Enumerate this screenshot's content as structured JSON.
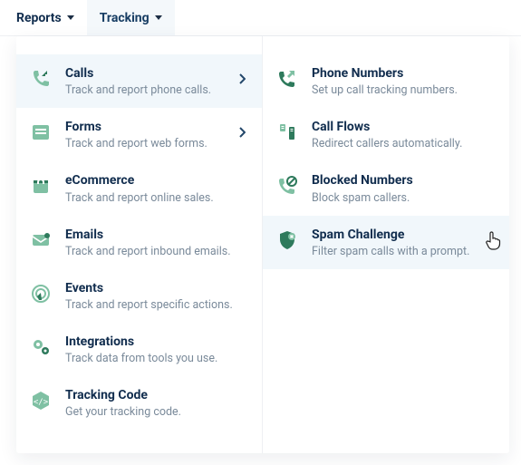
{
  "topnav": {
    "reports": "Reports",
    "tracking": "Tracking"
  },
  "left": [
    {
      "icon": "phone-in",
      "title": "Calls",
      "sub": "Track and report phone calls.",
      "chev": true,
      "hi": true
    },
    {
      "icon": "form",
      "title": "Forms",
      "sub": "Track and report web forms.",
      "chev": true,
      "hi": false
    },
    {
      "icon": "cart",
      "title": "eCommerce",
      "sub": "Track and report online sales.",
      "chev": false,
      "hi": false
    },
    {
      "icon": "mail",
      "title": "Emails",
      "sub": "Track and report inbound emails.",
      "chev": false,
      "hi": false
    },
    {
      "icon": "touch",
      "title": "Events",
      "sub": "Track and report specific actions.",
      "chev": false,
      "hi": false
    },
    {
      "icon": "gears",
      "title": "Integrations",
      "sub": "Track data from tools you use.",
      "chev": false,
      "hi": false
    },
    {
      "icon": "code",
      "title": "Tracking Code",
      "sub": "Get your tracking code.",
      "chev": false,
      "hi": false
    }
  ],
  "right": [
    {
      "icon": "phone",
      "title": "Phone Numbers",
      "sub": "Set up call tracking numbers.",
      "hi": false,
      "cursor": false
    },
    {
      "icon": "flow",
      "title": "Call Flows",
      "sub": "Redirect callers automatically.",
      "hi": false,
      "cursor": false
    },
    {
      "icon": "block",
      "title": "Blocked Numbers",
      "sub": "Block spam callers.",
      "hi": false,
      "cursor": false
    },
    {
      "icon": "shield",
      "title": "Spam Challenge",
      "sub": "Filter spam calls with a prompt.",
      "hi": true,
      "cursor": true
    }
  ]
}
